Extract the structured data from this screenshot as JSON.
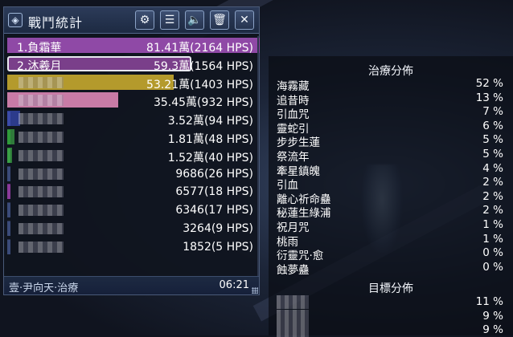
{
  "panel": {
    "title": "戰鬥統計",
    "buttons": [
      {
        "name": "settings-button",
        "icon": "gear-icon",
        "glyph": "⚙"
      },
      {
        "name": "menu-button",
        "icon": "menu-icon",
        "glyph": "☰"
      },
      {
        "name": "sound-button",
        "icon": "speaker-icon",
        "glyph": "🔈"
      },
      {
        "name": "clear-button",
        "icon": "trash-icon",
        "glyph": "🗑"
      },
      {
        "name": "close-button",
        "icon": "close-icon",
        "glyph": "✕"
      }
    ],
    "rows": [
      {
        "name": "1.負霜華",
        "value": "81.41萬(2164 HPS)",
        "color": "#8f49a6",
        "fill": 1.0,
        "strip": ""
      },
      {
        "name": "2.沐羲月",
        "value": "59.3萬(1564 HPS)",
        "color": "#7a3f8a",
        "fill": 0.73,
        "strip": "",
        "selected": true
      },
      {
        "name": "",
        "value": "53.21萬(1403 HPS)",
        "color": "#b49a2c",
        "fill": 0.66,
        "strip": ""
      },
      {
        "name": "",
        "value": "35.45萬(932 HPS)",
        "color": "#c87ba6",
        "fill": 0.44,
        "strip": ""
      },
      {
        "name": "",
        "value": "3.52萬(94 HPS)",
        "color": "#2c3b8c",
        "fill": 0.05,
        "strip": "#3b4aa8"
      },
      {
        "name": "",
        "value": "1.81萬(48 HPS)",
        "color": "#2f7a3a",
        "fill": 0.03,
        "strip": "#2f9a3a"
      },
      {
        "name": "",
        "value": "1.52萬(40 HPS)",
        "color": "#2f7a3a",
        "fill": 0.02,
        "strip": "#3aa046"
      },
      {
        "name": "",
        "value": "9686(26 HPS)",
        "color": "#2a3350",
        "fill": 0.01,
        "strip": "#3a4a78"
      },
      {
        "name": "",
        "value": "6577(18 HPS)",
        "color": "#6a2a7a",
        "fill": 0.01,
        "strip": "#8a3a9a"
      },
      {
        "name": "",
        "value": "6346(17 HPS)",
        "color": "#2a3350",
        "fill": 0.01,
        "strip": "#3a4a78"
      },
      {
        "name": "",
        "value": "3264(9 HPS)",
        "color": "#2a3350",
        "fill": 0.005,
        "strip": "#3a4a78"
      },
      {
        "name": "",
        "value": "1852(5 HPS)",
        "color": "#2a3350",
        "fill": 0.003,
        "strip": "#3a4a78"
      }
    ],
    "footer_label": "壹‧尹向天‧治療",
    "footer_time": "06:21"
  },
  "detail": {
    "heal_title": "治療分佈",
    "heal_rows": [
      {
        "name": "海霧藏",
        "pct": "52 %"
      },
      {
        "name": "追昔時",
        "pct": "13 %"
      },
      {
        "name": "引血咒",
        "pct": "7 %"
      },
      {
        "name": "靈蛇引",
        "pct": "6 %"
      },
      {
        "name": "步步生蓮",
        "pct": "5 %"
      },
      {
        "name": "祭流年",
        "pct": "5 %"
      },
      {
        "name": "牽星鎮魄",
        "pct": "4 %"
      },
      {
        "name": "引血",
        "pct": "2 %"
      },
      {
        "name": "離心祈命蠱",
        "pct": "2 %"
      },
      {
        "name": "秘蓮生綠浦",
        "pct": "2 %"
      },
      {
        "name": "祝月咒",
        "pct": "1 %"
      },
      {
        "name": "桃雨",
        "pct": "1 %"
      },
      {
        "name": "衍靈咒‧愈",
        "pct": "0 %"
      },
      {
        "name": "蝕夢蠱",
        "pct": "0 %"
      }
    ],
    "target_title": "目標分佈",
    "target_rows": [
      {
        "pct": "11 %"
      },
      {
        "pct": "9 %"
      },
      {
        "pct": "9 %"
      }
    ]
  }
}
